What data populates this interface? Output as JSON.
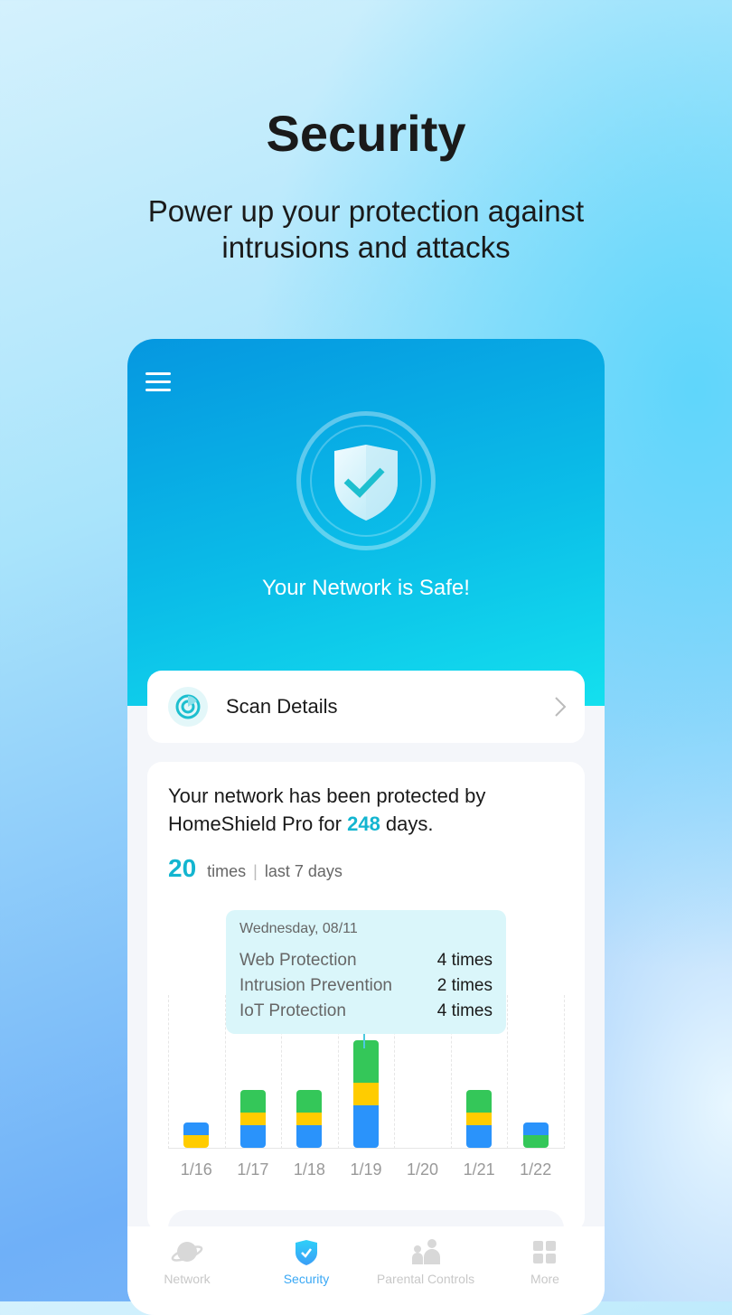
{
  "promo": {
    "title": "Security",
    "subtitle_line1": "Power up your protection against",
    "subtitle_line2": "intrusions and attacks"
  },
  "hero": {
    "status": "Your Network is Safe!",
    "icon": "shield-check-icon"
  },
  "scan": {
    "label": "Scan Details"
  },
  "summary": {
    "text_before": "Your network has been protected by HomeShield Pro for ",
    "days": "248",
    "text_after": " days.",
    "count": "20",
    "count_unit": "times",
    "separator": "|",
    "period": "last 7 days"
  },
  "colors": {
    "accent": "#13b5d0",
    "web": "#2a93fb",
    "intrusion": "#ffcc00",
    "iot": "#34c759",
    "tab_active": "#3aa8f5"
  },
  "tooltip": {
    "date": "Wednesday, 08/11",
    "rows": [
      {
        "label": "Web Protection",
        "value": "4 times"
      },
      {
        "label": "Intrusion Prevention",
        "value": "2 times"
      },
      {
        "label": "IoT Protection",
        "value": "4 times"
      }
    ]
  },
  "chart_data": {
    "type": "bar",
    "stacked": true,
    "categories": [
      "1/16",
      "1/17",
      "1/18",
      "1/19",
      "1/20",
      "1/21",
      "1/22"
    ],
    "series": [
      {
        "name": "Web Protection",
        "color": "#2a93fb",
        "values": [
          1,
          2,
          2,
          4,
          0,
          2,
          1
        ]
      },
      {
        "name": "Intrusion Prevention",
        "color": "#ffcc00",
        "values": [
          1,
          1,
          1,
          2,
          0,
          1,
          0
        ]
      },
      {
        "name": "IoT Protection",
        "color": "#34c759",
        "values": [
          0,
          2,
          2,
          4,
          0,
          2,
          1
        ]
      }
    ],
    "stack_order_bottom_up": [
      [
        "Intrusion Prevention",
        "Web Protection"
      ],
      [
        "Web Protection",
        "Intrusion Prevention",
        "IoT Protection"
      ],
      [
        "Web Protection",
        "Intrusion Prevention",
        "IoT Protection"
      ],
      [
        "Web Protection",
        "Intrusion Prevention",
        "IoT Protection"
      ],
      [],
      [
        "Web Protection",
        "Intrusion Prevention",
        "IoT Protection"
      ],
      [
        "IoT Protection",
        "Web Protection"
      ]
    ],
    "grid": "vertical-dashed"
  },
  "tabs": [
    {
      "label": "Network",
      "icon": "planet-icon"
    },
    {
      "label": "Security",
      "icon": "shield-check-icon",
      "active": true
    },
    {
      "label": "Parental Controls",
      "icon": "family-icon"
    },
    {
      "label": "More",
      "icon": "grid-icon"
    }
  ]
}
